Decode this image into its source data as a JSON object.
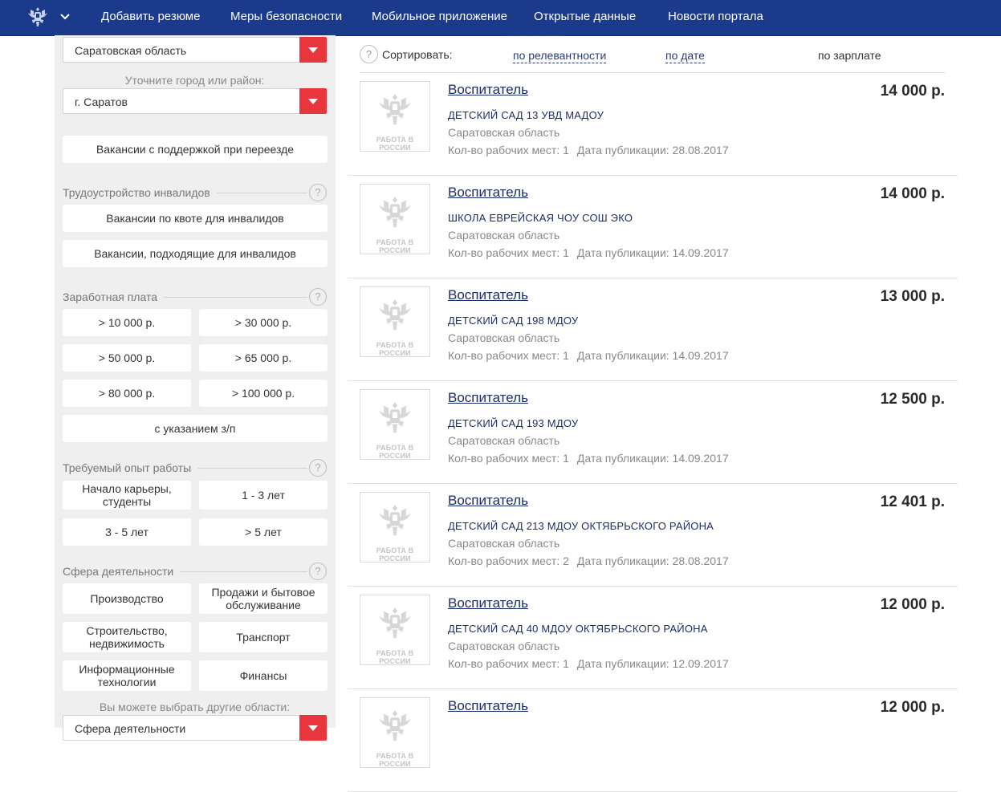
{
  "header": {
    "nav": [
      "Добавить резюме",
      "Меры безопасности",
      "Мобильное приложение",
      "Открытые данные",
      "Новости портала"
    ]
  },
  "sidebar": {
    "region_select": "Саратовская область",
    "city_label": "Уточните город или район:",
    "city_select": "г. Саратов",
    "relocation_button": "Вакансии с поддержкой при переезде",
    "disability": {
      "title": "Трудоустройство инвалидов",
      "quota_button": "Вакансии по квоте для инвалидов",
      "suitable_button": "Вакансии, подходящие для инвалидов"
    },
    "salary": {
      "title": "Заработная плата",
      "options": [
        "> 10 000 р.",
        "> 30 000 р.",
        "> 50 000 р.",
        "> 65 000 р.",
        "> 80 000 р.",
        "> 100 000 р."
      ],
      "with_salary": "с указанием з/п"
    },
    "experience": {
      "title": "Требуемый опыт работы",
      "options": [
        "Начало карьеры, студенты",
        "1 - 3 лет",
        "3 - 5 лет",
        "> 5 лет"
      ]
    },
    "sphere": {
      "title": "Сфера деятельности",
      "options": [
        "Производство",
        "Продажи и бытовое обслуживание",
        "Строительство, недвижимость",
        "Транспорт",
        "Информационные технологии",
        "Финансы"
      ],
      "other_label": "Вы можете выбрать другие области:",
      "other_select": "Сфера деятельности"
    },
    "help_glyph": "?"
  },
  "sort": {
    "label": "Сортировать:",
    "options": [
      "по релевантности",
      "по дате",
      "по зарплате"
    ],
    "help_glyph": "?"
  },
  "logo_text": "РАБОТА В РОССИИ",
  "vacancies": [
    {
      "title": "Воспитатель",
      "salary": "14 000 р.",
      "employer": "ДЕТСКИЙ САД 13 УВД МАДОУ",
      "region": "Саратовская область",
      "places": "Кол-во рабочих мест:  1",
      "date": "Дата публикации:  28.08.2017"
    },
    {
      "title": "Воспитатель",
      "salary": "14 000 р.",
      "employer": "ШКОЛА ЕВРЕЙСКАЯ ЧОУ СОШ ЭКО",
      "region": "Саратовская область",
      "places": "Кол-во рабочих мест:  1",
      "date": "Дата публикации:  14.09.2017"
    },
    {
      "title": "Воспитатель",
      "salary": "13 000 р.",
      "employer": "ДЕТСКИЙ САД 198 МДОУ",
      "region": "Саратовская область",
      "places": "Кол-во рабочих мест:  1",
      "date": "Дата публикации:  14.09.2017"
    },
    {
      "title": "Воспитатель",
      "salary": "12 500 р.",
      "employer": "ДЕТСКИЙ САД 193 МДОУ",
      "region": "Саратовская область",
      "places": "Кол-во рабочих мест:  1",
      "date": "Дата публикации:  14.09.2017"
    },
    {
      "title": "Воспитатель",
      "salary": "12 401 р.",
      "employer": "ДЕТСКИЙ САД 213 МДОУ ОКТЯБРЬСКОГО РАЙОНА",
      "region": "Саратовская область",
      "places": "Кол-во рабочих мест:  2",
      "date": "Дата публикации:  28.08.2017"
    },
    {
      "title": "Воспитатель",
      "salary": "12 000 р.",
      "employer": "ДЕТСКИЙ САД 40 МДОУ ОКТЯБРЬСКОГО РАЙОНА",
      "region": "Саратовская область",
      "places": "Кол-во рабочих мест:  1",
      "date": "Дата публикации:  12.09.2017"
    },
    {
      "title": "Воспитатель",
      "salary": "12 000 р.",
      "employer": "",
      "region": "",
      "places": "",
      "date": ""
    }
  ]
}
